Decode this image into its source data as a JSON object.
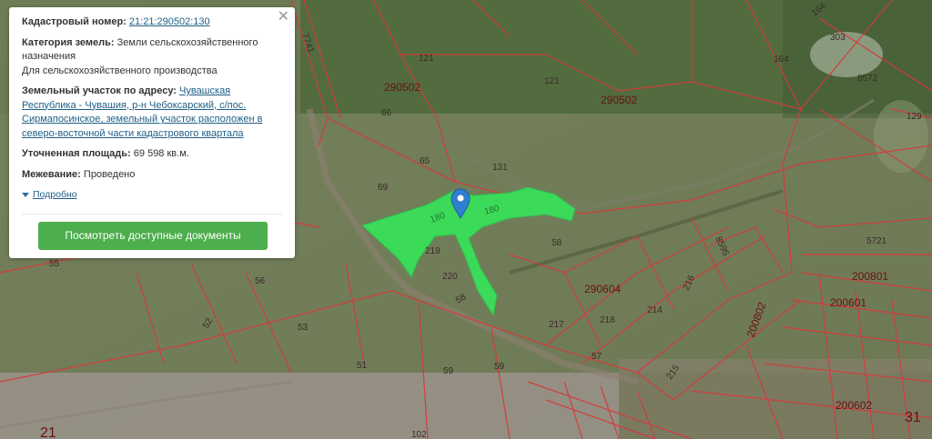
{
  "card": {
    "cadastral_label": "Кадастровый номер:",
    "cadastral_value": "21:21:290502:130",
    "category_label": "Категория земель:",
    "category_value": "Земли сельскохозяйственного назначения",
    "category_use": "Для сельскохозяйственного производства",
    "address_label": "Земельный участок по адресу:",
    "address_value": "Чувашская Республика - Чувашия, р-н Чебоксарский, с/пос. Сирмапосинское, земельный участок расположен в северо-восточной части кадастрового квартала",
    "area_label": "Уточненная площадь:",
    "area_value": "69 598 кв.м.",
    "survey_label": "Межевание:",
    "survey_value": "Проведено",
    "details_link": "Подробно",
    "docs_button": "Посмотреть доступные документы",
    "close_symbol": "✕"
  },
  "map": {
    "quarters": [
      "290502",
      "290502",
      "290604",
      "200801",
      "200601",
      "200602",
      "200802"
    ],
    "parcels": [
      "7741",
      "121",
      "121",
      "164",
      "164",
      "303",
      "8572",
      "129",
      "66",
      "65",
      "69",
      "131",
      "180",
      "180",
      "219",
      "220",
      "58",
      "58",
      "55",
      "56",
      "53",
      "52",
      "51",
      "59",
      "59",
      "57",
      "217",
      "218",
      "214",
      "216",
      "215",
      "8595",
      "5721",
      "102",
      "21",
      "31"
    ],
    "colors": {
      "highlight": "#39e05a",
      "boundary": "#d63a3a",
      "marker": "#2f7fd0",
      "button": "#4cae4c",
      "link": "#1f5f86"
    },
    "icons": [
      "map-marker-icon",
      "close-icon",
      "chevron-down-icon"
    ]
  }
}
